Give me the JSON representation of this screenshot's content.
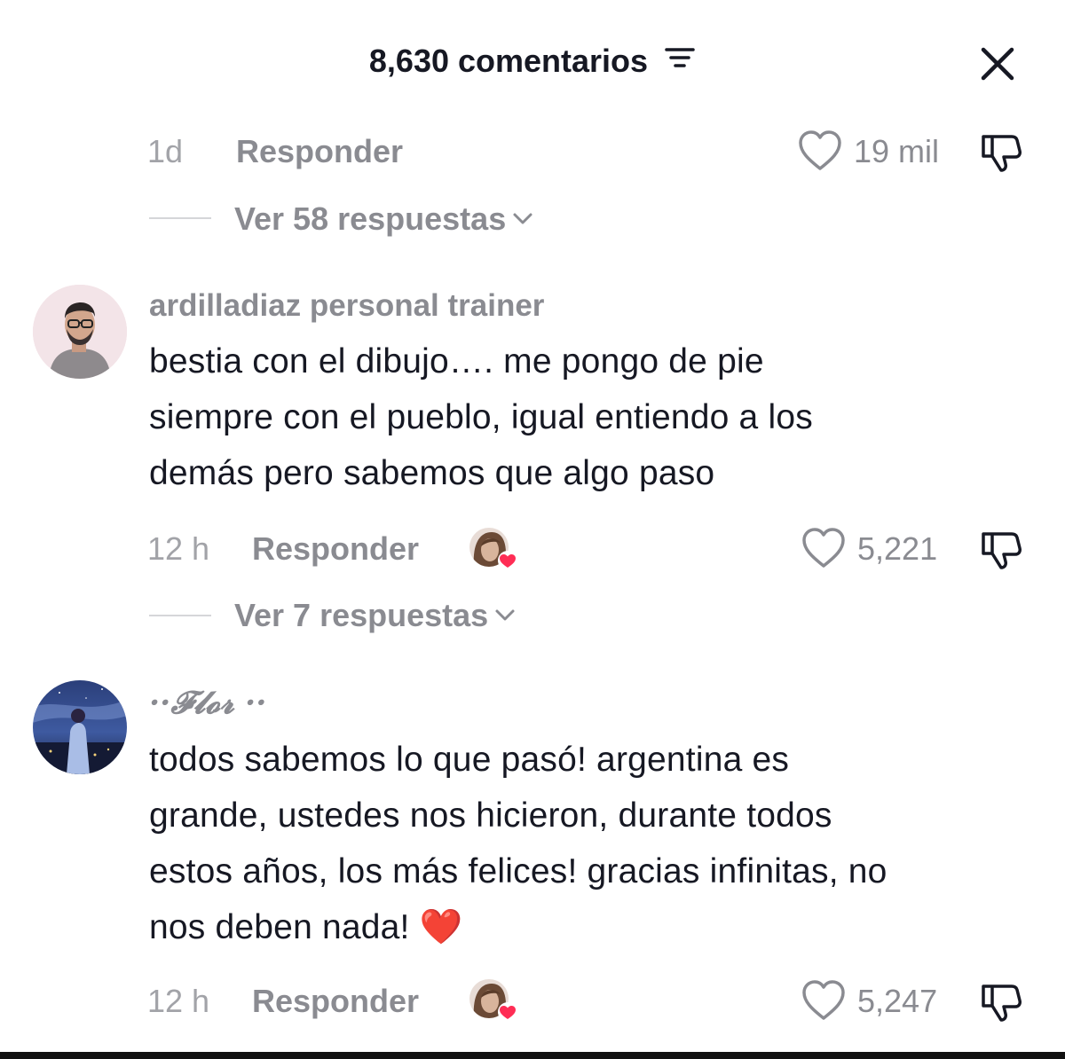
{
  "header": {
    "title": "8,630 comentarios",
    "sort_icon": "sort-filter-icon",
    "close_icon": "close-icon"
  },
  "comments": [
    {
      "time": "1d",
      "reply_label": "Responder",
      "likes": "19 mil",
      "view_replies": "Ver 58 respuestas"
    },
    {
      "username": "ardilladiaz personal trainer",
      "text_lines": [
        "bestia con el dibujo…. me pongo de pie",
        "siempre con el pueblo, igual entiendo a los",
        "demás pero sabemos que algo paso"
      ],
      "time": "12 h",
      "reply_label": "Responder",
      "likes": "5,221",
      "view_replies": "Ver 7 respuestas"
    },
    {
      "username": "··𝓕𝓵𝓸𝓻 ··",
      "text_lines": [
        "todos sabemos lo que pasó! argentina es",
        "grande, ustedes nos hicieron, durante todos",
        "estos años, los más felices! gracias infinitas, no",
        "nos deben nada! ❤️"
      ],
      "time": "12 h",
      "reply_label": "Responder",
      "likes": "5,247"
    }
  ],
  "colors": {
    "text": "#161823",
    "muted": "#8a8b91",
    "heart": "#ff2d55"
  }
}
